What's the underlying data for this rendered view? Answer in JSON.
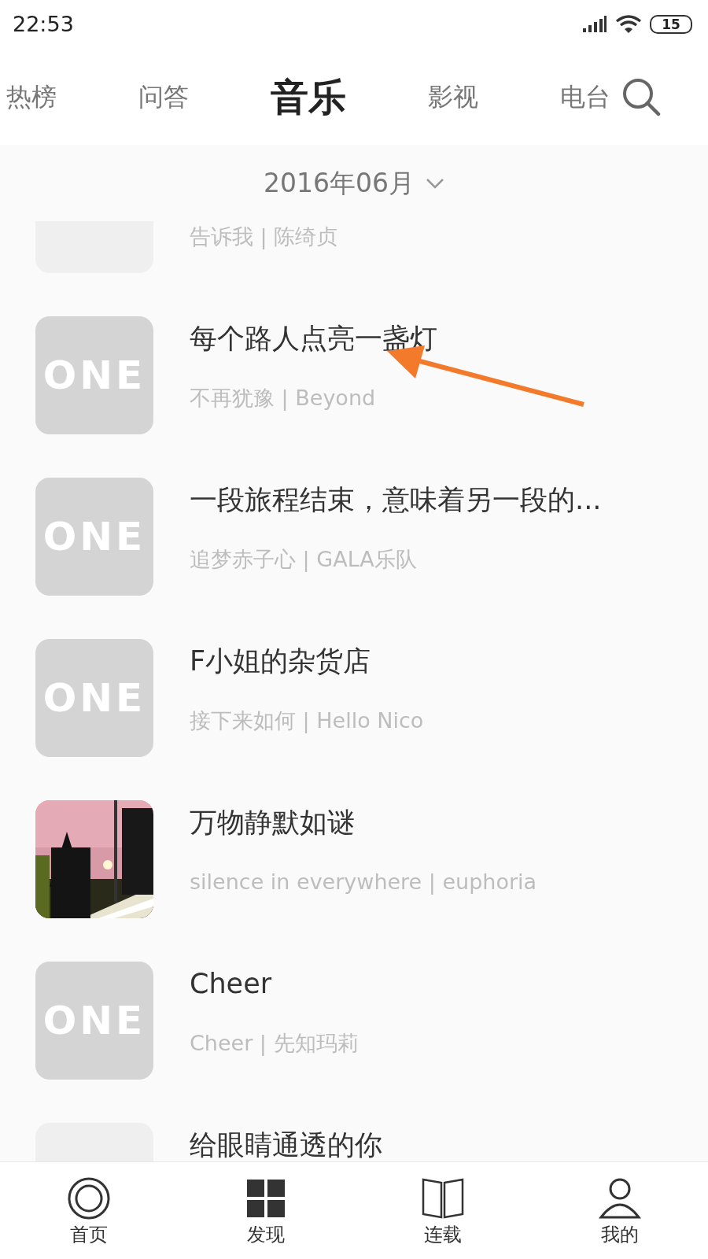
{
  "status_bar": {
    "time": "22:53",
    "battery": "15"
  },
  "tabs": [
    {
      "label": "热榜",
      "selected": false
    },
    {
      "label": "问答",
      "selected": false
    },
    {
      "label": "音乐",
      "selected": true
    },
    {
      "label": "影视",
      "selected": false
    },
    {
      "label": "电台",
      "selected": false
    }
  ],
  "date_picker": {
    "label": "2016年06月"
  },
  "songs": [
    {
      "kind": "blank",
      "subtitle": "告诉我 | 陈绮贞"
    },
    {
      "kind": "logo",
      "cover_text": "ONE",
      "title": "每个路人点亮一盏灯",
      "subtitle": "不再犹豫 | Beyond"
    },
    {
      "kind": "logo",
      "cover_text": "ONE",
      "title": "一段旅程结束，意味着另一段的...",
      "subtitle": "追梦赤子心 | GALA乐队"
    },
    {
      "kind": "logo",
      "cover_text": "ONE",
      "title": "F小姐的杂货店",
      "subtitle": "接下来如何 | Hello Nico"
    },
    {
      "kind": "picture",
      "title": "万物静默如谜",
      "subtitle": "silence in everywhere | euphoria"
    },
    {
      "kind": "logo",
      "cover_text": "ONE",
      "title": "Cheer",
      "subtitle": "Cheer | 先知玛莉"
    },
    {
      "kind": "blank",
      "title": "给眼睛通透的你"
    }
  ],
  "bottom_nav": [
    {
      "label": "首页"
    },
    {
      "label": "发现"
    },
    {
      "label": "连载"
    },
    {
      "label": "我的"
    }
  ]
}
